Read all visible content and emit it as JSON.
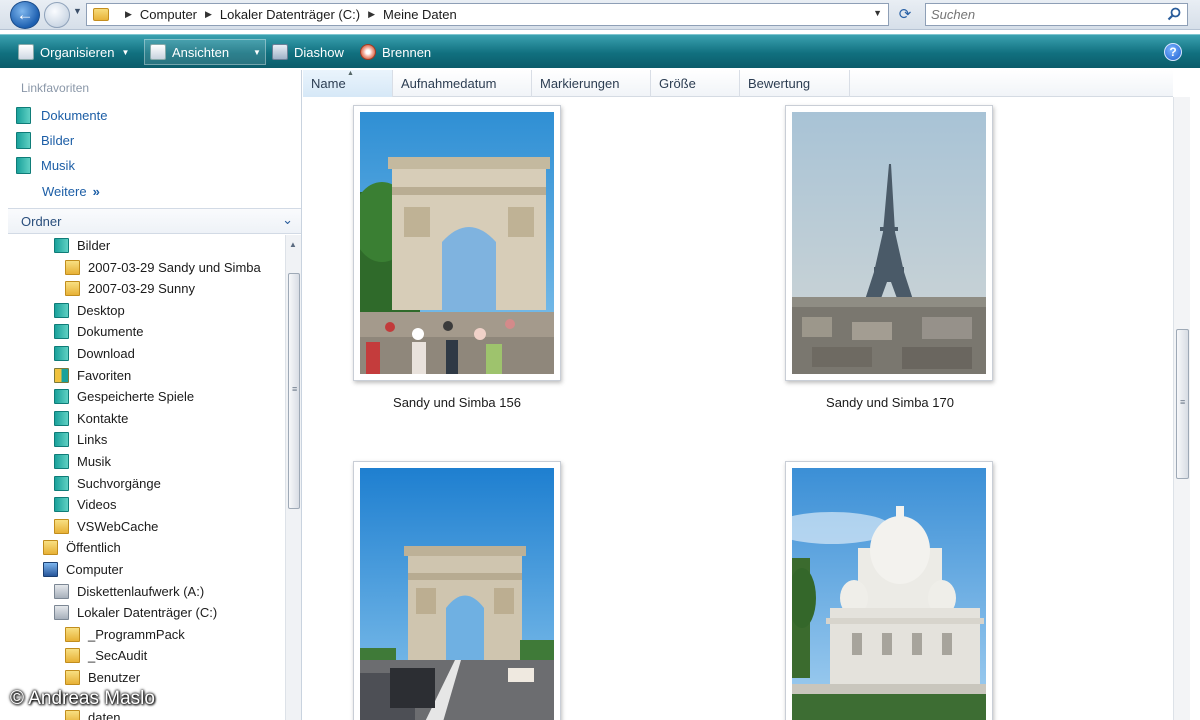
{
  "address_bar": {
    "breadcrumbs": [
      "Computer",
      "Lokaler Datenträger (C:)",
      "Meine Daten"
    ],
    "search_placeholder": "Suchen"
  },
  "toolbar": {
    "organize": "Organisieren",
    "views": "Ansichten",
    "slideshow": "Diashow",
    "burn": "Brennen",
    "help": "?"
  },
  "favorites": {
    "title": "Linkfavoriten",
    "items": [
      "Dokumente",
      "Bilder",
      "Musik"
    ],
    "more": "Weitere",
    "more_chevron": "»"
  },
  "folders": {
    "title": "Ordner",
    "tree": [
      {
        "label": "Bilder",
        "icon": "library-icon"
      },
      {
        "label": "2007-03-29 Sandy und Simba",
        "icon": "folder-icon"
      },
      {
        "label": "2007-03-29 Sunny",
        "icon": "folder-icon"
      },
      {
        "label": "Desktop",
        "icon": "library-icon"
      },
      {
        "label": "Dokumente",
        "icon": "library-icon"
      },
      {
        "label": "Download",
        "icon": "library-icon"
      },
      {
        "label": "Favoriten",
        "icon": "favorites-icon"
      },
      {
        "label": "Gespeicherte Spiele",
        "icon": "games-icon"
      },
      {
        "label": "Kontakte",
        "icon": "contacts-icon"
      },
      {
        "label": "Links",
        "icon": "library-icon"
      },
      {
        "label": "Musik",
        "icon": "music-icon"
      },
      {
        "label": "Suchvorgänge",
        "icon": "search-folder-icon"
      },
      {
        "label": "Videos",
        "icon": "video-icon"
      },
      {
        "label": "VSWebCache",
        "icon": "folder-icon"
      },
      {
        "label": "Öffentlich",
        "icon": "folder-icon"
      },
      {
        "label": "Computer",
        "icon": "computer-icon"
      },
      {
        "label": "Diskettenlaufwerk (A:)",
        "icon": "floppy-drive-icon"
      },
      {
        "label": "Lokaler Datenträger (C:)",
        "icon": "hard-drive-icon"
      },
      {
        "label": "_ProgrammPack",
        "icon": "folder-icon"
      },
      {
        "label": "_SecAudit",
        "icon": "folder-icon"
      },
      {
        "label": "Benutzer",
        "icon": "folder-icon"
      },
      {
        "label": "daten",
        "icon": "folder-icon"
      }
    ]
  },
  "columns": [
    "Name",
    "Aufnahmedatum",
    "Markierungen",
    "Größe",
    "Bewertung"
  ],
  "files": [
    {
      "name": "Sandy und Simba 156",
      "subject": "Arc de Triomphe"
    },
    {
      "name": "Sandy und Simba 170",
      "subject": "Eiffel Tower"
    },
    {
      "name": "",
      "subject": "Arc de Triomphe"
    },
    {
      "name": "",
      "subject": "Sacré-Cœur"
    }
  ],
  "watermark": "© Andreas Maslo",
  "colors": {
    "toolbar": "#11707f",
    "link": "#1c5ea6",
    "sky": "#3f9ad6"
  }
}
